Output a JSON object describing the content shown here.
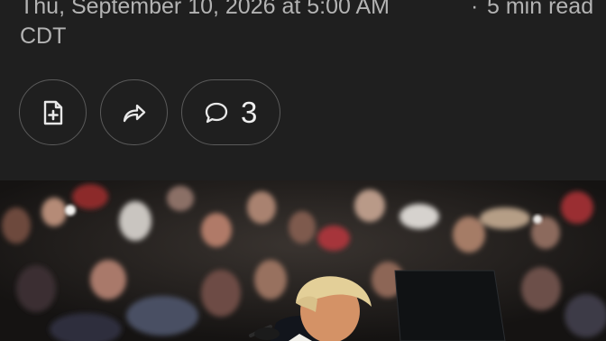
{
  "article": {
    "date_line": "Thu, September 10, 2026 at 5:00 AM",
    "timezone": "CDT",
    "separator": "·",
    "read_time": "5 min read"
  },
  "actions": {
    "comment_count": "3",
    "save_icon": "file-plus-icon",
    "share_icon": "share-arrow-icon",
    "comment_icon": "speech-bubble-icon"
  },
  "hero_image": {
    "scene": "crowd-rally-with-speaker"
  }
}
